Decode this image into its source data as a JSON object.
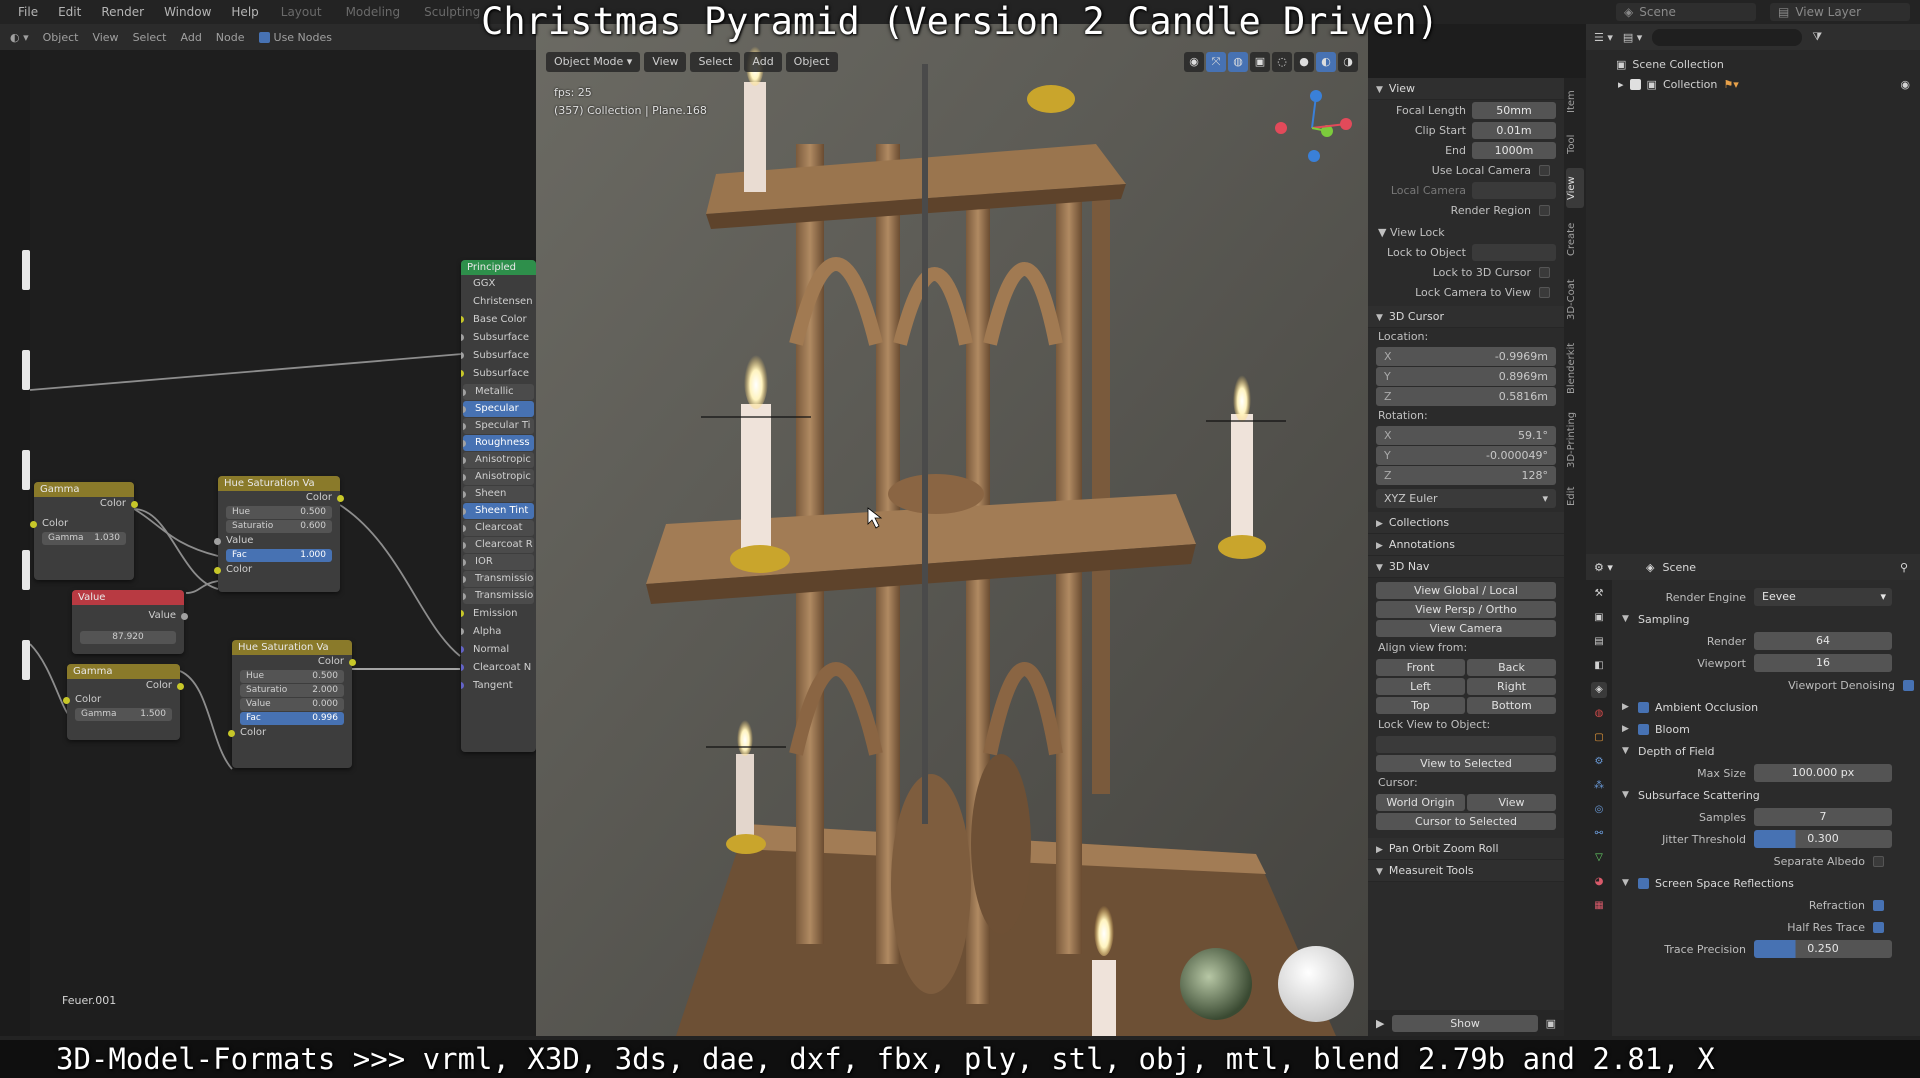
{
  "overlay": {
    "title": "Christmas Pyramid (Version 2 Candle Driven)",
    "bottom": "3D-Model-Formats >>> vrml, X3D, 3ds, dae, dxf, fbx, ply, stl, obj, mtl, blend 2.79b and 2.81, X"
  },
  "menubar": {
    "items": [
      "File",
      "Edit",
      "Render",
      "Window",
      "Help"
    ],
    "workspaces": [
      "Layout",
      "Modeling",
      "Sculpting"
    ],
    "scene": "Scene",
    "view_layer": "View Layer"
  },
  "node_editor": {
    "header": [
      "Object",
      "View",
      "Select",
      "Add",
      "Node"
    ],
    "use_nodes": "Use Nodes",
    "node_group_name": "Feuer.001",
    "principled": {
      "title": "Principled",
      "rows": [
        "GGX",
        "Christensen",
        "Base Color",
        "Subsurface",
        "Subsurface",
        "Subsurface",
        "Metallic",
        "Specular",
        "Specular Ti",
        "Roughness",
        "Anisotropic",
        "Anisotropic",
        "Sheen",
        "Sheen Tint",
        "Clearcoat",
        "Clearcoat R",
        "IOR",
        "Transmissio",
        "Transmissio",
        "Emission",
        "Alpha",
        "Normal",
        "Clearcoat N",
        "Tangent"
      ]
    },
    "gamma1": {
      "title": "Gamma",
      "out": "Color",
      "in": "Color",
      "field": "Gamma",
      "value": "1.030"
    },
    "gamma2": {
      "title": "Gamma",
      "out": "Color",
      "in": "Color",
      "field": "Gamma",
      "value": "1.500"
    },
    "value_node": {
      "title": "Value",
      "out": "Value",
      "value": "87.920"
    },
    "hsv1": {
      "title": "Hue Saturation Va",
      "out": "Color",
      "hue_l": "Hue",
      "hue": "0.500",
      "sat_l": "Saturatio",
      "sat": "0.600",
      "val_l": "Value",
      "fac_l": "Fac",
      "fac": "1.000",
      "col_l": "Color"
    },
    "hsv2": {
      "title": "Hue Saturation Va",
      "out": "Color",
      "hue_l": "Hue",
      "hue": "0.500",
      "sat_l": "Saturatio",
      "sat": "2.000",
      "val_l": "Value",
      "val": "0.000",
      "fac_l": "Fac",
      "fac": "0.996",
      "col_l": "Color"
    }
  },
  "viewport": {
    "mode": "Object Mode",
    "menus": [
      "View",
      "Select",
      "Add",
      "Object"
    ],
    "fps": "fps: 25",
    "info": "(357) Collection | Plane.168"
  },
  "npanel": {
    "tabs": [
      "Item",
      "Tool",
      "View",
      "Create",
      "3D-Coat",
      "Blenderkit",
      "3D-Printing",
      "Edit"
    ],
    "view": {
      "title": "View",
      "focal_length_l": "Focal Length",
      "focal_length": "50mm",
      "clip_start_l": "Clip Start",
      "clip_start": "0.01m",
      "end_l": "End",
      "end": "1000m",
      "use_local_camera": "Use Local Camera",
      "local_camera": "Local Camera",
      "render_region": "Render Region"
    },
    "view_lock": {
      "title": "View Lock",
      "lock_to_object": "Lock to Object",
      "lock_to_cursor": "Lock to 3D Cursor",
      "lock_camera": "Lock Camera to View"
    },
    "cursor": {
      "title": "3D Cursor",
      "location": "Location:",
      "x": "-0.9969m",
      "y": "0.8969m",
      "z": "0.5816m",
      "rotation": "Rotation:",
      "rx": "59.1°",
      "ry": "-0.000049°",
      "rz": "128°",
      "mode": "XYZ Euler"
    },
    "collections": "Collections",
    "annotations": "Annotations",
    "nav": {
      "title": "3D Nav",
      "global_local": "View Global / Local",
      "persp_ortho": "View Persp / Ortho",
      "camera": "View Camera",
      "align_from": "Align view from:",
      "front": "Front",
      "back": "Back",
      "left": "Left",
      "right": "Right",
      "top": "Top",
      "bottom": "Bottom",
      "lock_view": "Lock View to Object:",
      "view_selected": "View to Selected",
      "cursor": "Cursor:",
      "world_origin": "World Origin",
      "view": "View",
      "cursor_to_selected": "Cursor to Selected"
    },
    "pan_orbit": "Pan Orbit Zoom Roll",
    "measure": "Measureit Tools",
    "show": "Show"
  },
  "outliner": {
    "root": "Scene Collection",
    "collection": "Collection"
  },
  "properties": {
    "header": "Scene",
    "render_engine_l": "Render Engine",
    "render_engine": "Eevee",
    "sampling": "Sampling",
    "render_l": "Render",
    "render": "64",
    "viewport_l": "Viewport",
    "viewport": "16",
    "denoise": "Viewport Denoising",
    "ao": "Ambient Occlusion",
    "bloom": "Bloom",
    "dof": "Depth of Field",
    "max_size_l": "Max Size",
    "max_size": "100.000 px",
    "sss": "Subsurface Scattering",
    "samples_l": "Samples",
    "samples": "7",
    "jitter_l": "Jitter Threshold",
    "jitter": "0.300",
    "sep_albedo": "Separate Albedo",
    "ssr": "Screen Space Reflections",
    "refraction": "Refraction",
    "half_res": "Half Res Trace",
    "trace_l": "Trace Precision",
    "trace": "0.250"
  }
}
